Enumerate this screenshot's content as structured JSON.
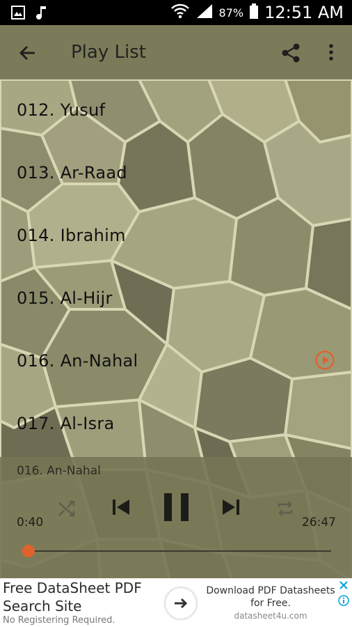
{
  "status_bar": {
    "battery_percent": "87%",
    "time": "12:51 AM"
  },
  "app_bar": {
    "title": "Play List"
  },
  "playlist": {
    "tracks": [
      {
        "label": "012. Yusuf"
      },
      {
        "label": "013. Ar-Raad"
      },
      {
        "label": "014. Ibrahim"
      },
      {
        "label": "015. Al-Hijr"
      },
      {
        "label": "016. An-Nahal"
      },
      {
        "label": "017. Al-Isra"
      }
    ],
    "playing_index": 4
  },
  "player": {
    "now_playing": "016. An-Nahal",
    "current_time": "0:40",
    "total_time": "26:47",
    "progress": 0.025
  },
  "ad": {
    "headline_line1": "Free DataSheet PDF",
    "headline_line2": "Search Site",
    "tagline": "No Registering Required.",
    "right_line1": "Download PDF Datasheets",
    "right_line2": "for Free.",
    "domain": "datasheet4u.com"
  },
  "colors": {
    "accent": "#e0622b",
    "app_bar": "#7c7b59",
    "player_bg": "#767654"
  }
}
